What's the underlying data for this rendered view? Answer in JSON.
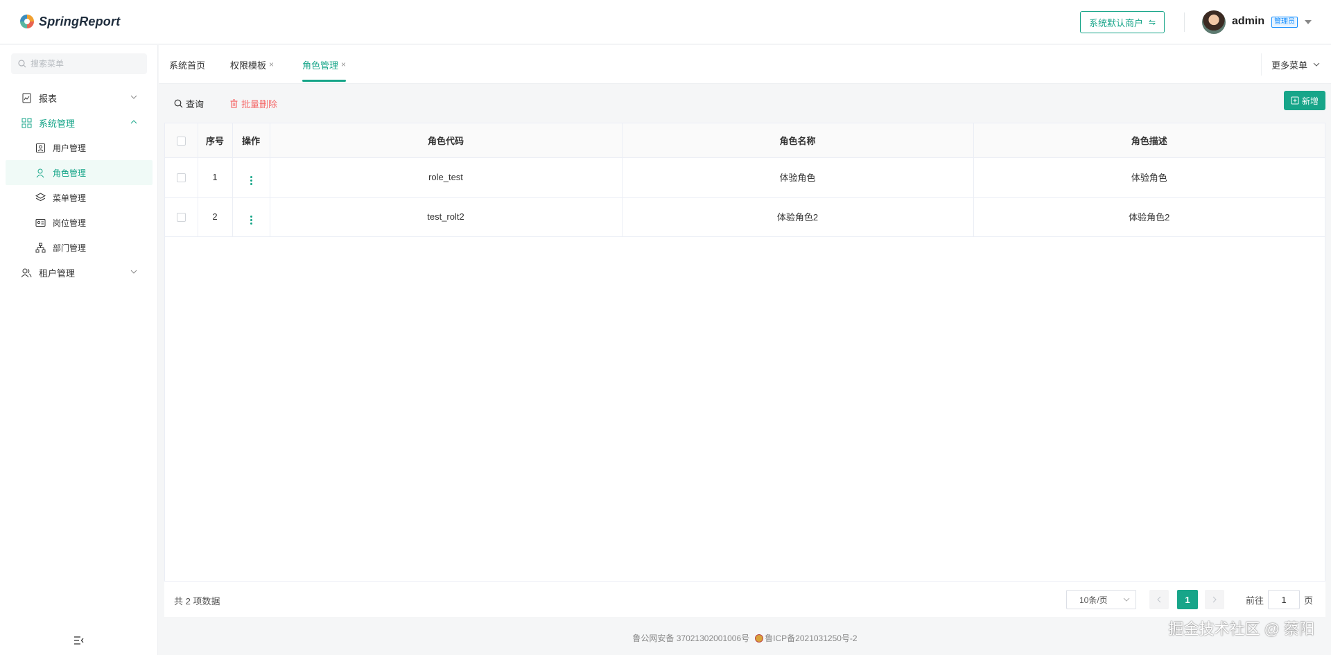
{
  "app": {
    "brand": "SpringReport"
  },
  "header": {
    "tenant_button": "系统默认商户",
    "username": "admin",
    "role_badge": "管理员"
  },
  "sidebar": {
    "search_placeholder": "搜索菜单",
    "items": [
      {
        "label": "报表",
        "icon": "report-icon"
      },
      {
        "label": "系统管理",
        "icon": "grid-icon"
      },
      {
        "label": "租户管理",
        "icon": "users-icon"
      }
    ],
    "sub_items": [
      {
        "label": "用户管理",
        "icon": "user-card-icon"
      },
      {
        "label": "角色管理",
        "icon": "user-icon"
      },
      {
        "label": "菜单管理",
        "icon": "layers-icon"
      },
      {
        "label": "岗位管理",
        "icon": "id-card-icon"
      },
      {
        "label": "部门管理",
        "icon": "org-icon"
      }
    ]
  },
  "tabs": [
    {
      "label": "系统首页"
    },
    {
      "label": "权限模板"
    },
    {
      "label": "角色管理"
    }
  ],
  "tabs_more": "更多菜单",
  "toolbar": {
    "query": "查询",
    "batch_delete": "批量删除",
    "add": "新增"
  },
  "table": {
    "columns": [
      "序号",
      "操作",
      "角色代码",
      "角色名称",
      "角色描述"
    ],
    "rows": [
      {
        "index": "1",
        "code": "role_test",
        "name": "体验角色",
        "desc": "体验角色"
      },
      {
        "index": "2",
        "code": "test_rolt2",
        "name": "体验角色2",
        "desc": "体验角色2"
      }
    ]
  },
  "pagination": {
    "total": "共 2 项数据",
    "page_size": "10条/页",
    "current": "1",
    "goto_prefix": "前往",
    "goto_value": "1",
    "goto_suffix": "页"
  },
  "footer": {
    "police": "鲁公网安备 37021302001006号",
    "icp": "鲁ICP备2021031250号-2"
  },
  "watermark": "掘金技术社区 @ 蔡阳",
  "colors": {
    "accent": "#17a589",
    "danger": "#f56c6c",
    "badge": "#1890ff"
  }
}
